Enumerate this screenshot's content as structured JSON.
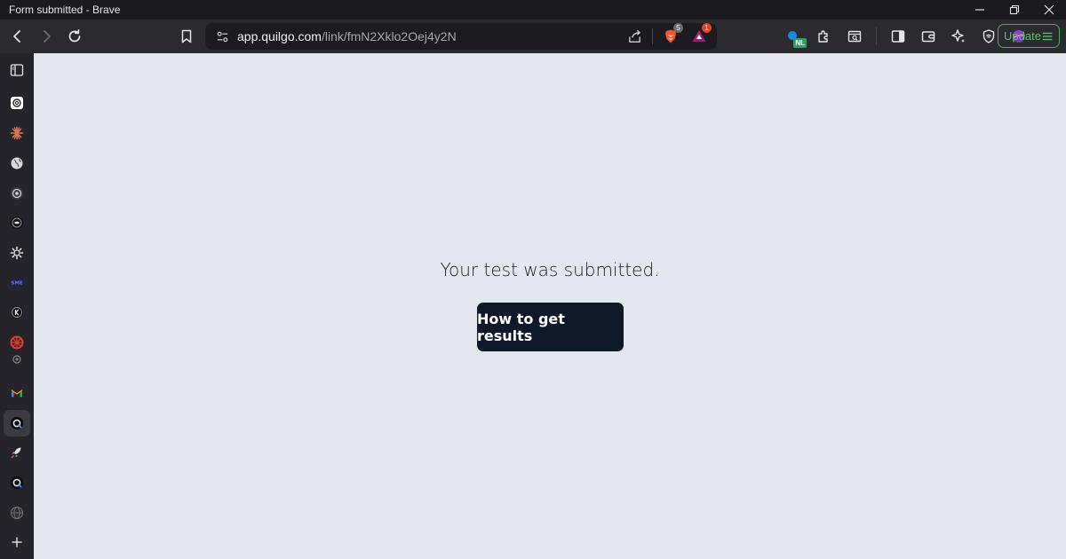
{
  "window": {
    "title": "Form submitted - Brave"
  },
  "toolbar": {
    "url_host": "app.quilgo.com",
    "url_path": "/link/fmN2Xklo2Oej4y2N",
    "brave_shield_count": "5",
    "rewards_count": "1",
    "profile_badge": "NL",
    "update_label": "Update"
  },
  "sidebar": {
    "items": [
      "sidebar-panel",
      "chatgpt",
      "claude",
      "globe",
      "openai-alt",
      "bot",
      "settings-gear",
      "sme",
      "k-app",
      "red-app",
      "gmail",
      "quilgo-active",
      "rocket",
      "quilgo",
      "web",
      "add"
    ]
  },
  "main": {
    "message": "Your test was submitted.",
    "button_label": "How to get results"
  },
  "colors": {
    "page_bg": "#e5e7ee",
    "button_bg": "#0f1929",
    "chrome_bg": "#2a2a2f",
    "update_green": "#63c070"
  }
}
